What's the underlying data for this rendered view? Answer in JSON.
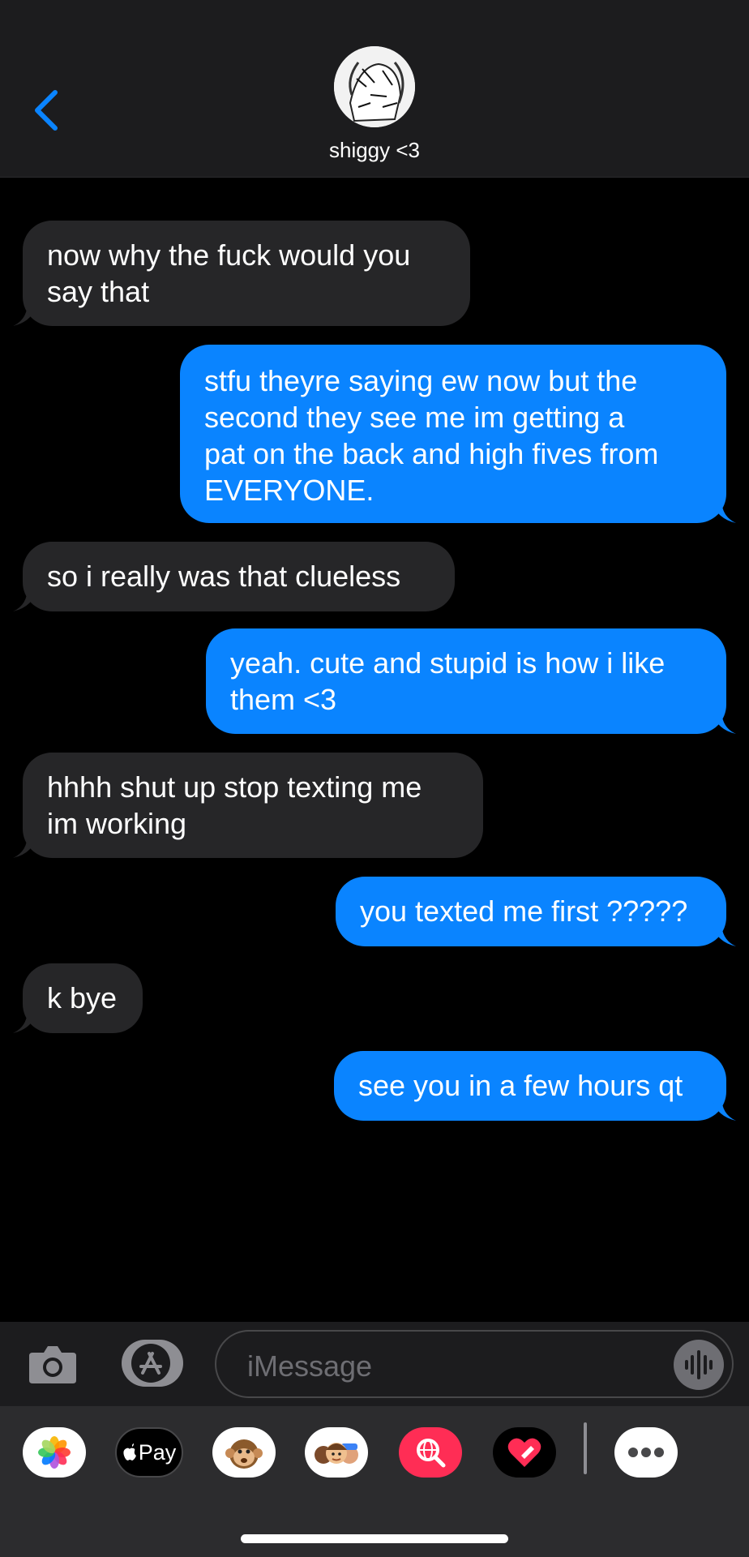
{
  "header": {
    "contact_name": "shiggy <3"
  },
  "messages": [
    {
      "side": "incoming",
      "lines": [
        "now why the fuck would you",
        "say that"
      ]
    },
    {
      "side": "outgoing",
      "lines": [
        "stfu theyre saying ew now but the",
        "second they see me im getting a",
        "pat on the back and high fives from",
        "EVERYONE."
      ]
    },
    {
      "side": "incoming",
      "lines": [
        "so i really was that clueless"
      ]
    },
    {
      "side": "outgoing",
      "lines": [
        "yeah. cute and stupid is how i like",
        "them <3"
      ]
    },
    {
      "side": "incoming",
      "lines": [
        "hhhh shut up stop texting me",
        "im working"
      ]
    },
    {
      "side": "outgoing",
      "lines": [
        "you texted me first ?????"
      ]
    },
    {
      "side": "incoming",
      "lines": [
        "k bye"
      ]
    },
    {
      "side": "outgoing",
      "lines": [
        "see you in a few hours qt"
      ]
    }
  ],
  "composer": {
    "placeholder": "iMessage"
  },
  "apps": [
    {
      "name": "photos-app-icon"
    },
    {
      "name": "apple-pay-app-icon",
      "label": "Pay"
    },
    {
      "name": "memoji-monkey-icon"
    },
    {
      "name": "memoji-stickers-icon"
    },
    {
      "name": "web-images-search-icon"
    },
    {
      "name": "digital-touch-heart-icon"
    },
    {
      "name": "more-apps-icon"
    }
  ],
  "colors": {
    "incoming_bubble": "#262628",
    "outgoing_bubble": "#0a84ff",
    "accent": "#0a84ff"
  }
}
